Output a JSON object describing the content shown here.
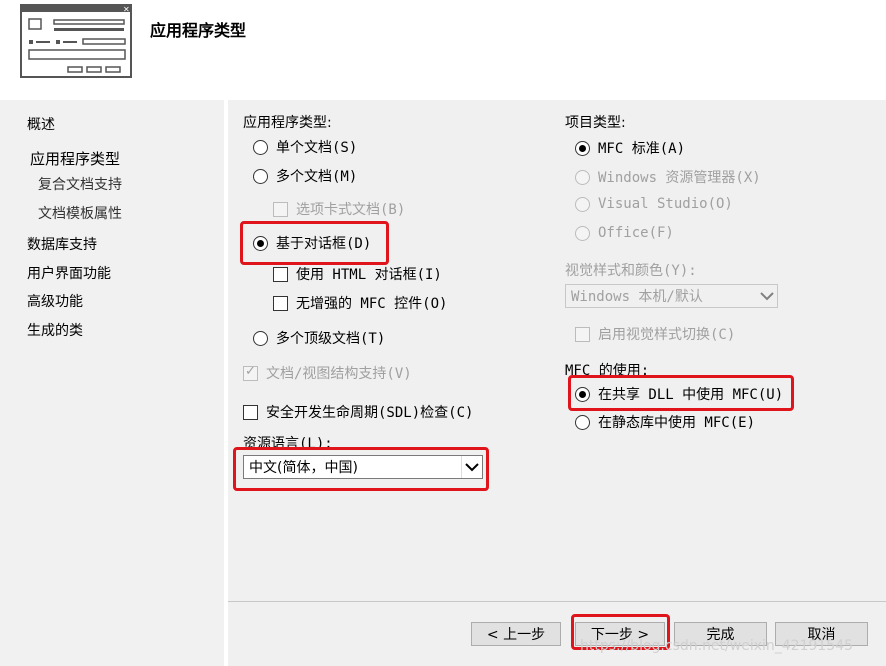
{
  "header": {
    "title": "应用程序类型"
  },
  "nav": {
    "items": [
      "概述",
      "应用程序类型",
      "复合文档支持",
      "文档模板属性",
      "数据库支持",
      "用户界面功能",
      "高级功能",
      "生成的类"
    ]
  },
  "app_type": {
    "label": "应用程序类型:",
    "single_doc": "单个文档(S)",
    "multi_doc": "多个文档(M)",
    "tabbed_docs": "选项卡式文档(B)",
    "dialog_based": "基于对话框(D)",
    "use_html_dialog": "使用 HTML 对话框(I)",
    "no_enhanced_mfc": "无增强的 MFC 控件(O)",
    "multi_top_level": "多个顶级文档(T)",
    "doc_view": "文档/视图结构支持(V)",
    "sdl": "安全开发生命周期(SDL)检查(C)",
    "selected": "基于对话框(D)"
  },
  "resource_lang": {
    "label": "资源语言(L):",
    "value": "中文(简体，中国)"
  },
  "project_type": {
    "label": "项目类型:",
    "mfc_standard": "MFC 标准(A)",
    "windows_explorer": "Windows 资源管理器(X)",
    "visual_studio": "Visual Studio(O)",
    "office": "Office(F)"
  },
  "visual_style": {
    "label": "视觉样式和颜色(Y):",
    "value": "Windows 本机/默认",
    "toggle": "启用视觉样式切换(C)"
  },
  "mfc_use": {
    "label": "MFC 的使用:",
    "shared_dll": "在共享 DLL 中使用 MFC(U)",
    "static_lib": "在静态库中使用 MFC(E)",
    "selected": "在共享 DLL 中使用 MFC(U)"
  },
  "buttons": {
    "prev": "< 上一步",
    "next": "下一步 >",
    "finish": "完成",
    "cancel": "取消"
  },
  "watermark": "https://blog.csdn.net/weixin_42191545",
  "colors": {
    "highlight": "#e0141b",
    "panel": "#f0f0f0",
    "nav": "#f1f1f1"
  }
}
